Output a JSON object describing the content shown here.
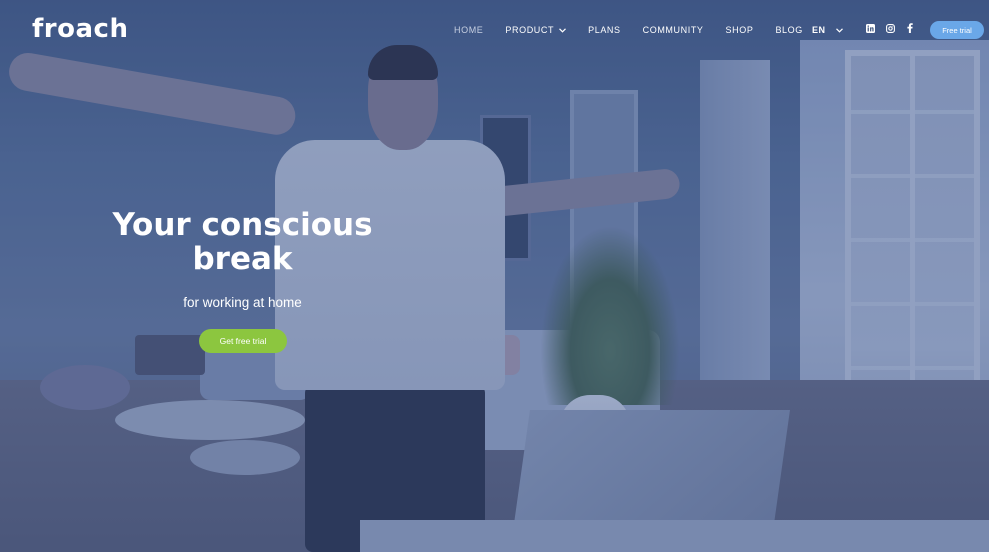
{
  "brand": {
    "logo_text": "froach"
  },
  "nav": {
    "items": [
      {
        "label": "HOME",
        "active": true,
        "has_dropdown": false
      },
      {
        "label": "PRODUCT",
        "active": false,
        "has_dropdown": true
      },
      {
        "label": "PLANS",
        "active": false,
        "has_dropdown": false
      },
      {
        "label": "COMMUNITY",
        "active": false,
        "has_dropdown": false
      },
      {
        "label": "SHOP",
        "active": false,
        "has_dropdown": false
      },
      {
        "label": "BLOG",
        "active": false,
        "has_dropdown": false
      }
    ],
    "language": "EN",
    "socials": [
      "linkedin-icon",
      "instagram-icon",
      "facebook-icon"
    ],
    "cta_label": "Free trial"
  },
  "hero": {
    "title_line1": "Your conscious",
    "title_line2": "break",
    "subtitle": "for working at home",
    "cta_label": "Get free trial"
  },
  "colors": {
    "nav_cta_bg": "#6aa7e8",
    "hero_cta_bg": "#8cc63f",
    "text": "#ffffff"
  }
}
